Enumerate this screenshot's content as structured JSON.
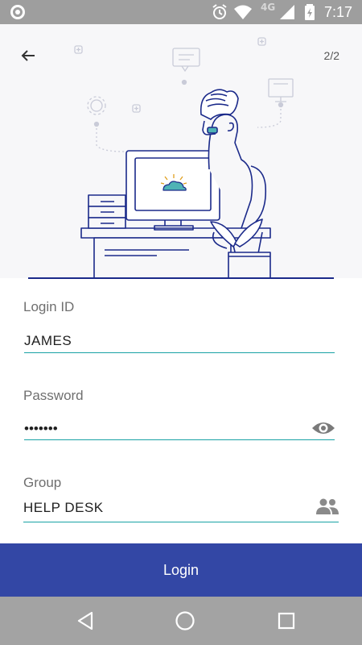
{
  "status_bar": {
    "network_label": "4G",
    "time": "7:17",
    "icons": [
      "app-notification-icon",
      "alarm-icon",
      "wifi-icon",
      "signal-icon",
      "battery-charging-icon"
    ]
  },
  "header": {
    "back_icon": "arrow-left-icon",
    "page_indicator": "2/2"
  },
  "form": {
    "login_id": {
      "label": "Login ID",
      "value": "JAMES"
    },
    "password": {
      "label": "Password",
      "value": "•••••••",
      "toggle_icon": "eye-icon"
    },
    "group": {
      "label": "Group",
      "value": "HELP DESK",
      "picker_icon": "people-icon"
    }
  },
  "login_button": {
    "label": "Login"
  },
  "colors": {
    "accent": "#3347a5",
    "underline": "#19a2a5",
    "illustration_stroke": "#1b2a8a",
    "cloud": "#4fb3b5",
    "status_bar": "#9e9e9e",
    "nav_bar": "#a3a3a3"
  },
  "nav_bar": {
    "icons": [
      "back-triangle-icon",
      "home-circle-icon",
      "recents-square-icon"
    ]
  }
}
